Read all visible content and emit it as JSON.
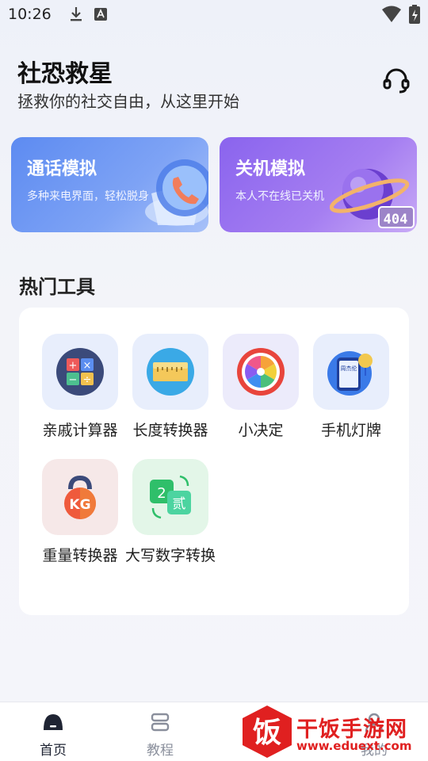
{
  "status_bar": {
    "time": "10:26"
  },
  "header": {
    "title": "社恐救星",
    "subtitle": "拯救你的社交自由，从这里开始"
  },
  "cards": [
    {
      "title": "通话模拟",
      "desc": "多种来电界面，轻松脱身"
    },
    {
      "title": "关机模拟",
      "desc": "本人不在线已关机",
      "badge": "404"
    }
  ],
  "hot_tools": {
    "title": "热门工具",
    "items": [
      {
        "label": "亲戚计算器",
        "icon": "calculator-icon",
        "bg": "#e8eefc"
      },
      {
        "label": "长度转换器",
        "icon": "ruler-icon",
        "bg": "#e8eefc"
      },
      {
        "label": "小决定",
        "icon": "spinner-wheel-icon",
        "bg": "#ecebfb"
      },
      {
        "label": "手机灯牌",
        "icon": "phone-lightboard-icon",
        "bg": "#e8eefc"
      },
      {
        "label": "重量转换器",
        "icon": "kettlebell-icon",
        "bg": "#f6e8e8"
      },
      {
        "label": "大写数字转换",
        "icon": "number-convert-icon",
        "bg": "#e3f6e8"
      }
    ],
    "calc_symbols": [
      "+",
      "×",
      "−",
      "÷"
    ],
    "weight_unit": "KG",
    "convert_digit": "2",
    "convert_char": "贰",
    "lightboard_text": "周杰伦"
  },
  "bottom_nav": {
    "items": [
      {
        "label": "首页",
        "active": true
      },
      {
        "label": "教程",
        "active": false
      },
      {
        "label": "我的",
        "active": false
      }
    ]
  },
  "watermark": {
    "brand": "干饭手游网",
    "url": "www.eduext.com",
    "logo_char": "饭"
  },
  "colors": {
    "accent": "#5d8bf1",
    "nav_active": "#1f2433",
    "nav_inactive": "#8a8f9c",
    "watermark": "#e02020"
  }
}
